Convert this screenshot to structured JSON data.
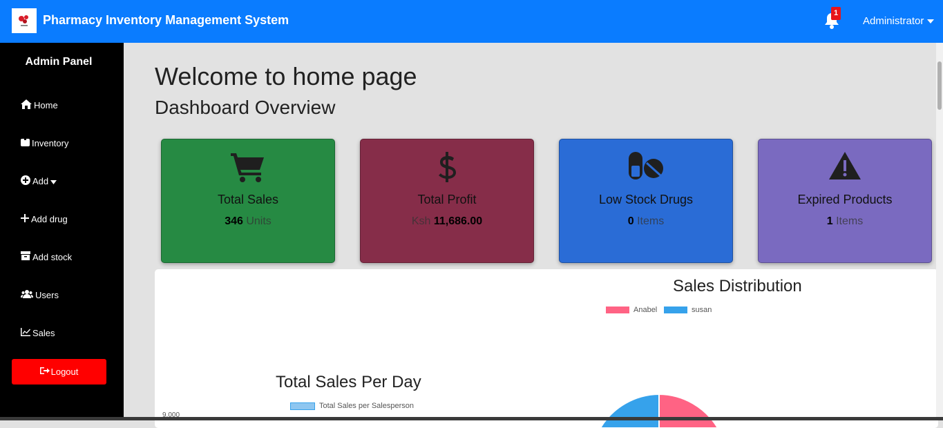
{
  "header": {
    "title": "Pharmacy Inventory Management System",
    "notification_count": "1",
    "user_menu": "Administrator",
    "logo_icon": "pharmacy-logo",
    "bell_icon": "bell-icon"
  },
  "sidebar": {
    "title": "Admin Panel",
    "items": [
      {
        "label": "Home",
        "icon": "home-icon"
      },
      {
        "label": "Inventory",
        "icon": "box-icon"
      },
      {
        "label": "Add",
        "icon": "plus-circle-icon"
      },
      {
        "label": "Add drug",
        "icon": "plus-icon"
      },
      {
        "label": "Add stock",
        "icon": "archive-icon"
      },
      {
        "label": "Users",
        "icon": "users-icon"
      },
      {
        "label": "Sales",
        "icon": "chart-line-icon"
      }
    ],
    "logout": "Logout"
  },
  "main": {
    "welcome": "Welcome to home page",
    "subheading": "Dashboard Overview",
    "cards": [
      {
        "label": "Total Sales",
        "prefix": "",
        "value": "346",
        "suffix": "Units",
        "color": "#268a43",
        "icon": "cart-icon"
      },
      {
        "label": "Total Profit",
        "prefix": "Ksh",
        "value": "11,686.00",
        "suffix": "",
        "color": "#862d49",
        "icon": "dollar-icon"
      },
      {
        "label": "Low Stock Drugs",
        "prefix": "",
        "value": "0",
        "suffix": "Items",
        "color": "#2a6cd6",
        "icon": "pills-icon"
      },
      {
        "label": "Expired Products",
        "prefix": "",
        "value": "1",
        "suffix": "Items",
        "color": "#7a6ac0",
        "icon": "warning-icon"
      }
    ]
  },
  "charts": {
    "sales_distribution": {
      "title": "Sales Distribution",
      "legend": [
        {
          "name": "Anabel",
          "color": "#ff6384"
        },
        {
          "name": "susan",
          "color": "#36a2eb"
        }
      ]
    },
    "sales_per_day": {
      "title": "Total Sales Per Day",
      "legend": "Total Sales per Salesperson",
      "legend_color": "#8ec6f0",
      "ytick": "9,000"
    }
  }
}
